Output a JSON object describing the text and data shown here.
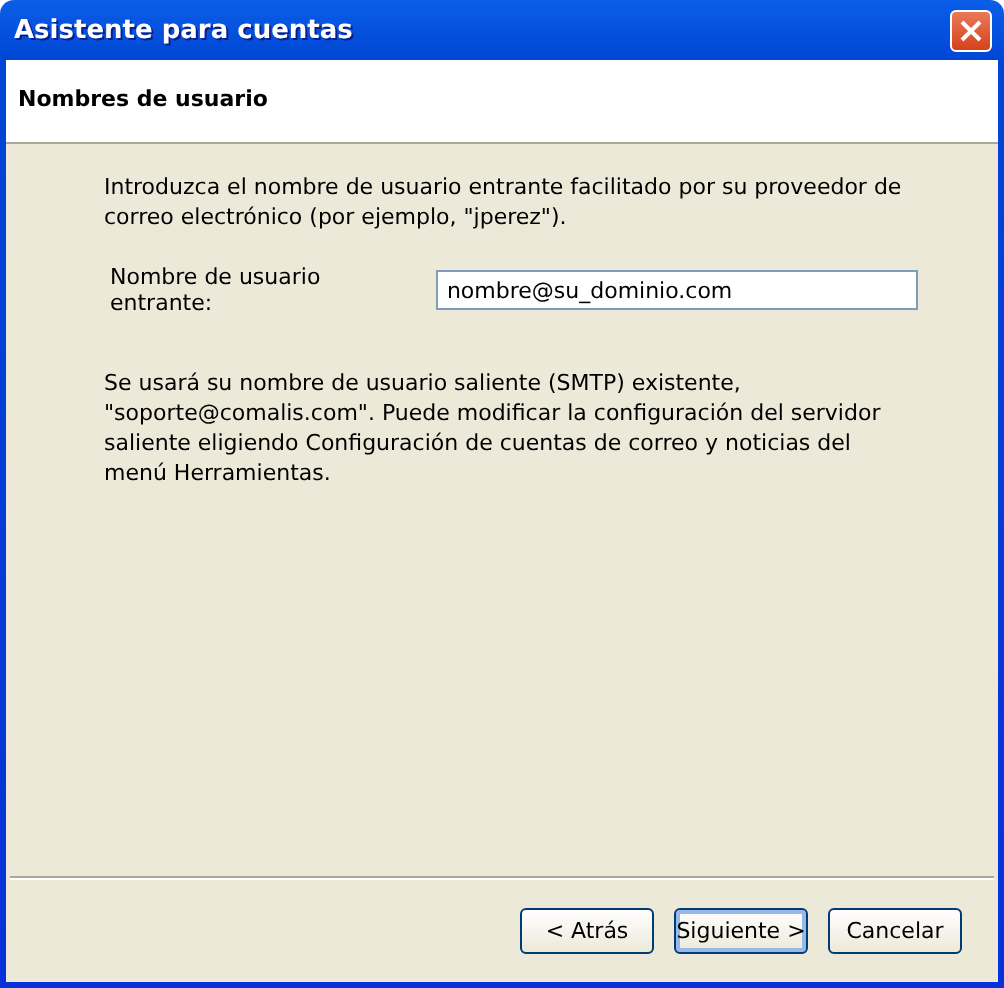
{
  "window": {
    "title": "Asistente para cuentas"
  },
  "header": {
    "title": "Nombres de usuario"
  },
  "intro": "Introduzca el nombre de usuario entrante facilitado por su proveedor de correo electrónico (por ejemplo, \"jperez\").",
  "field": {
    "label": "Nombre de usuario entrante:",
    "value": "nombre@su_dominio.com"
  },
  "note": "Se usará su nombre de usuario saliente (SMTP) existente, \"soporte@comalis.com\". Puede modificar la configuración del servidor saliente eligiendo Configuración de cuentas de correo y noticias del menú Herramientas.",
  "buttons": [
    {
      "label": "< Atrás",
      "default": false
    },
    {
      "label": "Siguiente >",
      "default": true
    },
    {
      "label": "Cancelar",
      "default": false
    }
  ]
}
